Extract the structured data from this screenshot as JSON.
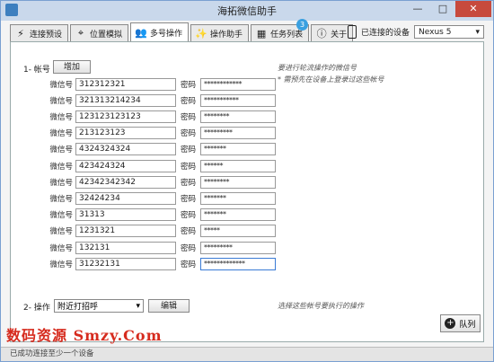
{
  "window": {
    "title": "海拓微信助手",
    "min": "—",
    "max": "□",
    "close": "✕"
  },
  "tabs": [
    {
      "label": "连接预设",
      "icon": "lightning-icon"
    },
    {
      "label": "位置模拟",
      "icon": "crosshair-icon"
    },
    {
      "label": "多号操作",
      "icon": "users-icon"
    },
    {
      "label": "操作助手",
      "icon": "magic-wand-icon"
    },
    {
      "label": "任务列表",
      "icon": "table-icon",
      "badge": "3"
    },
    {
      "label": "关于",
      "icon": "info-icon"
    }
  ],
  "active_tab": "多号操作",
  "device": {
    "label": "已连接的设备",
    "selected": "Nexus 5"
  },
  "accounts": {
    "section_label": "1- 帐号",
    "add_label": "增加",
    "account_label": "微信号",
    "password_label": "密码",
    "hint_line1": "要进行轮流操作的微信号",
    "hint_line2": "* 需预先在设备上登录过这些帐号",
    "rows": [
      {
        "account": "312312321",
        "password": "************"
      },
      {
        "account": "321313214234",
        "password": "***********"
      },
      {
        "account": "123123123123",
        "password": "********"
      },
      {
        "account": "213123123",
        "password": "*********"
      },
      {
        "account": "4324324324",
        "password": "*******"
      },
      {
        "account": "423424324",
        "password": "******"
      },
      {
        "account": "42342342342",
        "password": "********"
      },
      {
        "account": "32424234",
        "password": "*******"
      },
      {
        "account": "31313",
        "password": "*******"
      },
      {
        "account": "1231321",
        "password": "*****"
      },
      {
        "account": "132131",
        "password": "*********"
      },
      {
        "account": "31232131",
        "password": "*************"
      }
    ]
  },
  "operation": {
    "section_label": "2- 操作",
    "selected": "附近打招呼",
    "edit_label": "编辑",
    "hint": "选择这些帐号要执行的操作"
  },
  "queue_label": "队列",
  "watermark": "数码资源 Smzy.Com",
  "status": "已成功连接至少一个设备"
}
